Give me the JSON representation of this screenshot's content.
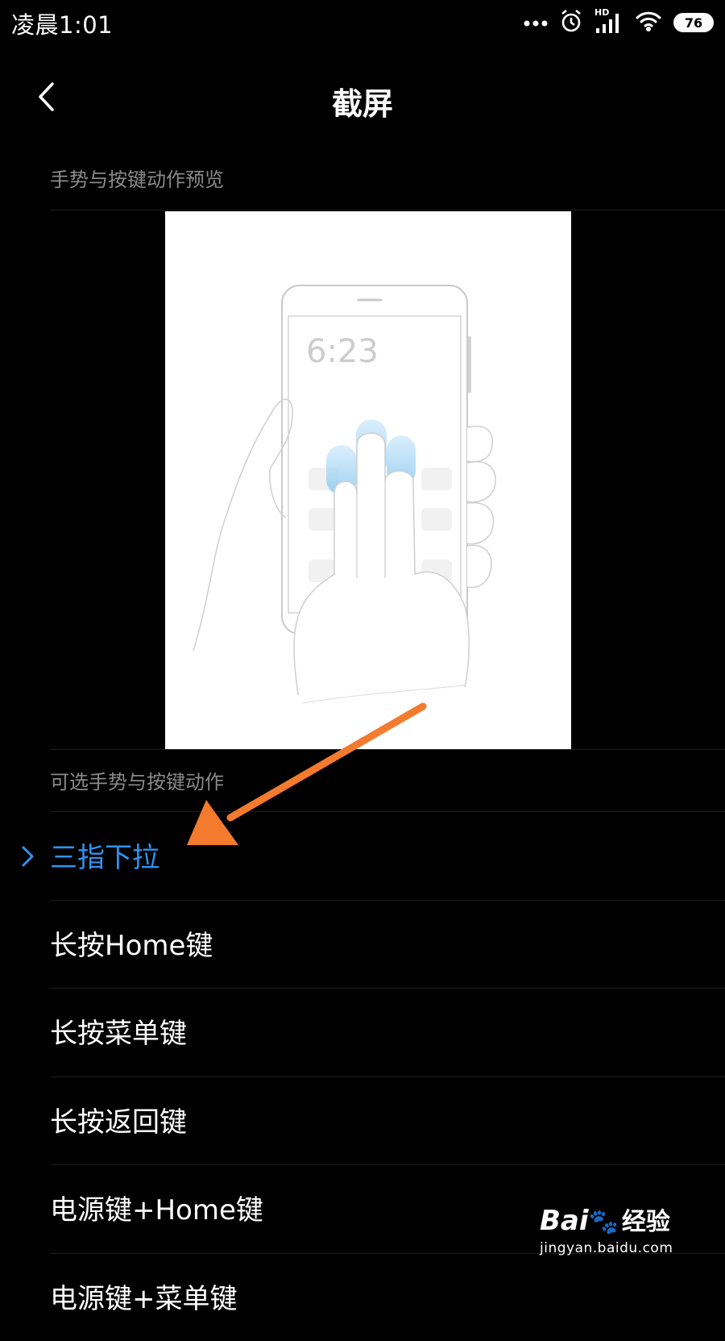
{
  "status_bar": {
    "time": "凌晨1:01",
    "battery": "76",
    "network_label": "HD"
  },
  "header": {
    "title": "截屏"
  },
  "preview": {
    "section_title": "手势与按键动作预览",
    "phone_clock": "6:23"
  },
  "options": {
    "section_title": "可选手势与按键动作",
    "items": [
      {
        "label": "三指下拉",
        "selected": true
      },
      {
        "label": "长按Home键"
      },
      {
        "label": "长按菜单键"
      },
      {
        "label": "长按返回键"
      },
      {
        "label": "电源键+Home键"
      },
      {
        "label": "电源键+菜单键"
      }
    ]
  },
  "watermark": {
    "brand": "Bai",
    "brand2": "经验",
    "url": "jingyan.baidu.com"
  },
  "colors": {
    "accent": "#2f93f0",
    "annotation_arrow": "#f47a2e",
    "background": "#000000"
  }
}
